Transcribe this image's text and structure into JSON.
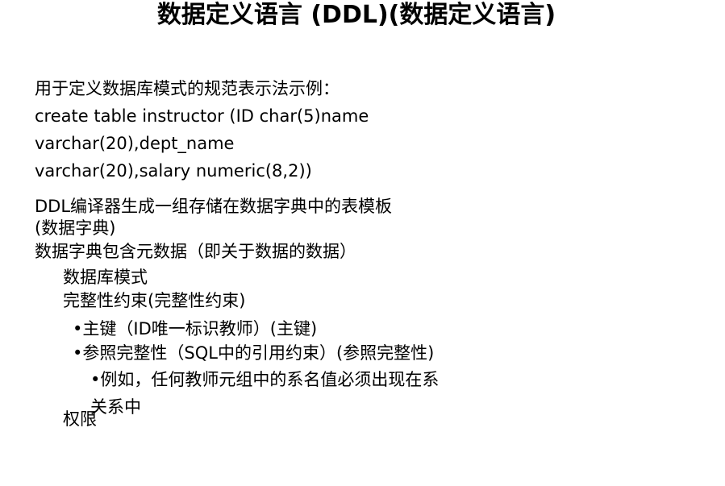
{
  "title": "数据定义语言 (DDL)(数据定义语言)",
  "intro": "用于定义数据库模式的规范表示法示例：",
  "code": [
    "create table instructor (ID char(5)name",
    "varchar(20),dept_name",
    "varchar(20),salary numeric(8,2))"
  ],
  "compiler": [
    "DDL编译器生成一组存储在数据字典中的表模板",
    "(数据字典)"
  ],
  "dictionary": {
    "heading": "数据字典包含元数据（即关于数据的数据）",
    "items": [
      "数据库模式",
      "完整性约束(完整性约束)"
    ],
    "constraints": [
      "•主键（ID唯一标识教师）(主键)",
      "•参照完整性（SQL中的引用约束）(参照完整性)"
    ],
    "example": [
      "•例如，任何教师元组中的系名值必须出现在系",
      "关系中"
    ],
    "last_item": "权限"
  }
}
